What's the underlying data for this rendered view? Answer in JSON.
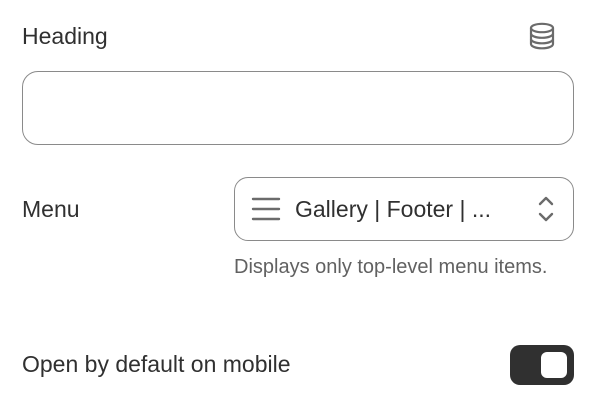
{
  "heading_field": {
    "label": "Heading",
    "value": "",
    "source_icon": "database-icon"
  },
  "menu_field": {
    "label": "Menu",
    "selected_value": "Gallery | Footer | ...",
    "menu_icon": "hamburger-icon",
    "selector_icon": "chevron-up-down-icon",
    "help_text": "Displays only top-level menu items."
  },
  "mobile_toggle": {
    "label": "Open by default on mobile",
    "checked": true,
    "on_color": "#303030"
  }
}
